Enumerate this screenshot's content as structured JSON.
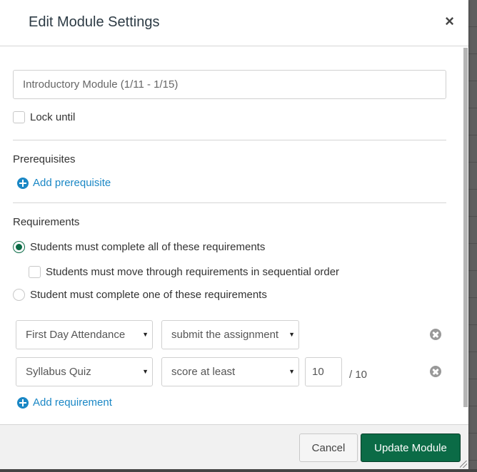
{
  "dialog": {
    "title": "Edit Module Settings",
    "close_label": "×"
  },
  "module": {
    "name_value": "Introductory Module (1/11 - 1/15)",
    "lock_until_label": "Lock until",
    "lock_until_checked": false
  },
  "prerequisites": {
    "heading": "Prerequisites",
    "add_label": "Add prerequisite"
  },
  "requirements": {
    "heading": "Requirements",
    "options": [
      {
        "label": "Students must complete all of these requirements",
        "selected": true
      },
      {
        "label": "Student must complete one of these requirements",
        "selected": false
      }
    ],
    "sequential_label": "Students must move through requirements in sequential order",
    "sequential_checked": false,
    "items": [
      {
        "item": "First Day Attendance",
        "condition": "submit the assignment"
      },
      {
        "item": "Syllabus Quiz",
        "condition": "score at least",
        "score": "10",
        "out_of": "/ 10"
      }
    ],
    "add_label": "Add requirement",
    "caret": "▼"
  },
  "footer": {
    "cancel_label": "Cancel",
    "update_label": "Update Module"
  },
  "colors": {
    "primary": "#0b6b46",
    "link": "#1a87c5"
  }
}
